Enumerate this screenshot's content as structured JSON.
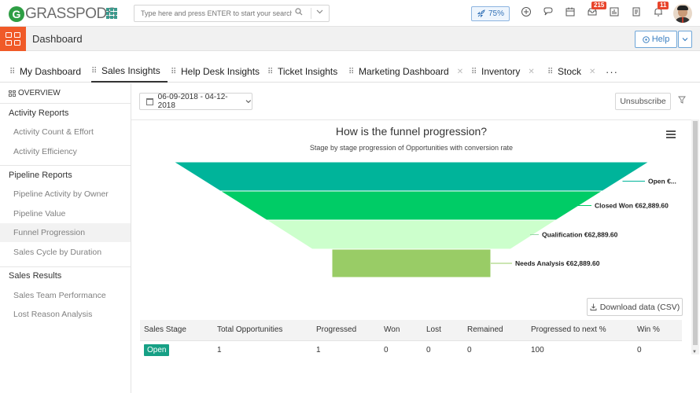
{
  "topbar": {
    "logo_text": "GRASSPODS",
    "logo_letter": "G",
    "search_placeholder": "Type here and press ENTER to start your search",
    "boost_label": "75%",
    "inbox_badge": "215",
    "notify_badge": "11"
  },
  "subbar": {
    "title": "Dashboard",
    "help_label": "Help"
  },
  "tabs": [
    {
      "label": "My Dashboard"
    },
    {
      "label": "Sales Insights"
    },
    {
      "label": "Help Desk Insights"
    },
    {
      "label": "Ticket Insights"
    },
    {
      "label": "Marketing Dashboard"
    },
    {
      "label": "Inventory"
    },
    {
      "label": "Stock"
    },
    {
      "label": "···"
    }
  ],
  "sidebar": {
    "overview": "OVERVIEW",
    "sections": [
      {
        "title": "Activity Reports",
        "items": [
          "Activity Count & Effort",
          "Activity Efficiency"
        ]
      },
      {
        "title": "Pipeline Reports",
        "items": [
          "Pipeline Activity by Owner",
          "Pipeline Value",
          "Funnel Progression",
          "Sales Cycle by Duration"
        ]
      },
      {
        "title": "Sales Results",
        "items": [
          "Sales Team Performance",
          "Lost Reason Analysis"
        ]
      }
    ]
  },
  "toolbar": {
    "date_range": "06-09-2018 - 04-12-2018",
    "unsubscribe": "Unsubscribe",
    "download_csv": "Download data (CSV)"
  },
  "chart_data": {
    "type": "funnel",
    "title": "How is the funnel progression?",
    "subtitle": "Stage by stage progression of Opportunities with conversion rate",
    "stages": [
      {
        "label": "Open €...",
        "color": "#00b49a"
      },
      {
        "label": "Closed Won €62,889.60",
        "color": "#00cc66"
      },
      {
        "label": "Qualification €62,889.60",
        "color": "#ccffcc"
      },
      {
        "label": "Needs Analysis €62,889.60",
        "color": "#99cc66"
      }
    ]
  },
  "table": {
    "headers": [
      "Sales Stage",
      "Total Opportunities",
      "Progressed",
      "Won",
      "Lost",
      "Remained",
      "Progressed to next %",
      "Win %"
    ],
    "rows": [
      [
        "Open",
        "1",
        "1",
        "0",
        "0",
        "0",
        "100",
        "0"
      ]
    ]
  },
  "colors": {
    "accent_orange": "#f05a28",
    "teal": "#16a085",
    "link_blue": "#3a7fc1",
    "badge_red": "#e8452c"
  }
}
